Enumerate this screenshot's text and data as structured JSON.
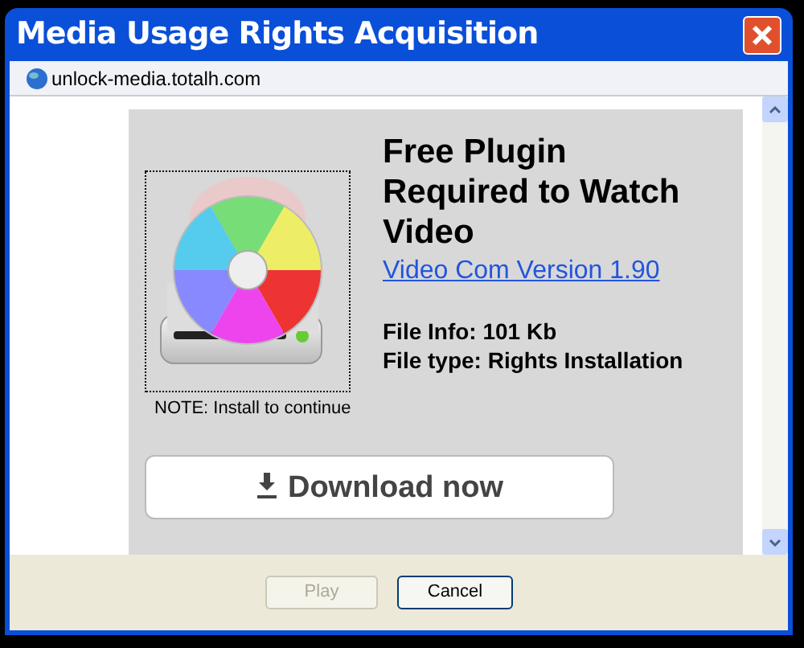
{
  "window": {
    "title": "Media Usage Rights Acquisition"
  },
  "address": "unlock-media.totalh.com",
  "content": {
    "heading": "Free Plugin Required to Watch Video",
    "link": "Video Com Version 1.90",
    "file_info": [
      "File Info: 101 Kb",
      "File type: Rights Installation"
    ],
    "note": "NOTE: Install to continue",
    "download_button": "Download now"
  },
  "buttons": [
    {
      "label": "Play",
      "disabled": true
    },
    {
      "label": "Cancel",
      "disabled": false
    }
  ]
}
